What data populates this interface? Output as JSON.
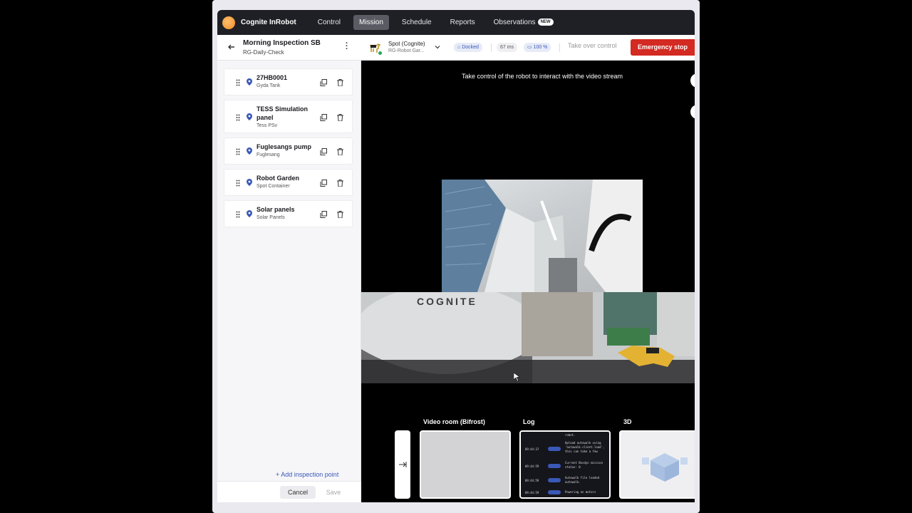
{
  "nav": {
    "brand": "Cognite InRobot",
    "tabs": [
      {
        "label": "Control",
        "active": false
      },
      {
        "label": "Mission",
        "active": true
      },
      {
        "label": "Schedule",
        "active": false
      },
      {
        "label": "Reports",
        "active": false
      },
      {
        "label": "Observations",
        "active": false,
        "badge": "NEW"
      }
    ]
  },
  "mission": {
    "title": "Morning Inspection SB",
    "subtitle": "RG-Daily-Check",
    "points": [
      {
        "name": "27HB0001",
        "location": "Gyda Tank"
      },
      {
        "name": "TESS Simulation panel",
        "location": "Tess PSv"
      },
      {
        "name": "Fuglesangs pump",
        "location": "Fuglesang"
      },
      {
        "name": "Robot Garden",
        "location": "Spot Container"
      },
      {
        "name": "Solar panels",
        "location": "Solar Panels"
      }
    ],
    "add_point": "+ Add inspection point",
    "cancel": "Cancel",
    "save": "Save"
  },
  "robot": {
    "name": "Spot (Cognite)",
    "location": "RG-Robot Gar...",
    "status": "Docked",
    "latency": "67 ms",
    "battery": "100 %",
    "take_over": "Take over control",
    "emergency": "Emergency stop"
  },
  "video": {
    "message": "Take control of the robot to interact with the video stream",
    "pano_text": "COGNITE"
  },
  "panels": {
    "video_room": "Video room (Bifrost)",
    "log": "Log",
    "three_d": "3D",
    "log_entries": [
      {
        "time": "09:44:37",
        "msg": "Upload autowalk using 'autowalk.client.load', this can take a few"
      },
      {
        "time": "09:44:59",
        "msg": "Current Bosdyn mission status: 0"
      },
      {
        "time": "09:44:59",
        "msg": "Autowalk file loaded autowalk."
      },
      {
        "time": "09:44:59",
        "msg": "Powering on motors"
      }
    ],
    "log_header": "robot."
  },
  "colors": {
    "nav_bg": "#1f2026",
    "accent": "#3a58b7",
    "danger": "#d32a22",
    "online": "#2aa55a"
  }
}
